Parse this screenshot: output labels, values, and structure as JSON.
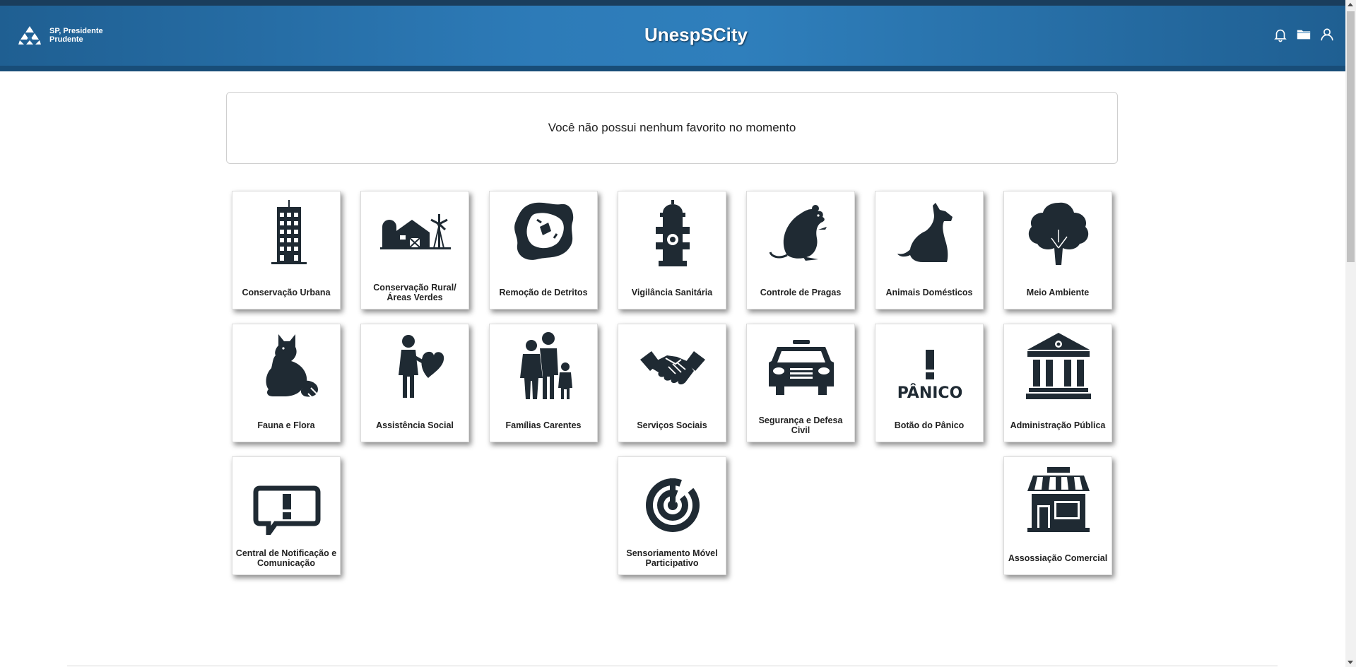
{
  "header": {
    "location": "SP, Presidente Prudente",
    "title": "UnespSCity",
    "icons": [
      "bell-icon",
      "folder-icon",
      "user-icon"
    ]
  },
  "favorites": {
    "empty_message": "Você não possui nenhum favorito no momento"
  },
  "tiles": [
    {
      "label": "Conservação Urbana",
      "icon": "building-icon"
    },
    {
      "label": "Conservação Rural/Áreas Verdes",
      "icon": "farm-icon"
    },
    {
      "label": "Remoção de Detritos",
      "icon": "debris-icon"
    },
    {
      "label": "Vigilância Sanitária",
      "icon": "fire-hydrant-icon"
    },
    {
      "label": "Controle de Pragas",
      "icon": "rat-icon"
    },
    {
      "label": "Animais Domésticos",
      "icon": "dog-icon"
    },
    {
      "label": "Meio Ambiente",
      "icon": "tree-icon"
    },
    {
      "label": "Fauna e Flora",
      "icon": "fox-icon"
    },
    {
      "label": "Assistência Social",
      "icon": "person-heart-icon"
    },
    {
      "label": "Famílias Carentes",
      "icon": "family-icon"
    },
    {
      "label": "Serviços Sociais",
      "icon": "handshake-icon"
    },
    {
      "label": "Segurança e Defesa Civil",
      "icon": "police-car-icon"
    },
    {
      "label": "Botão do Pânico",
      "icon": "panic-icon",
      "icon_text": "PÂNICO"
    },
    {
      "label": "Administração Pública",
      "icon": "government-building-icon"
    },
    {
      "label": "Central de Notificação e Comunicação",
      "icon": "notification-bubble-icon"
    },
    {
      "label": "Sensoriamento Móvel Participativo",
      "icon": "sensor-icon"
    },
    {
      "label": "Assossiação Comercial",
      "icon": "shop-icon"
    }
  ],
  "colors": {
    "header_blue": "#2d7bb8",
    "icon_dark": "#1f2a33"
  }
}
